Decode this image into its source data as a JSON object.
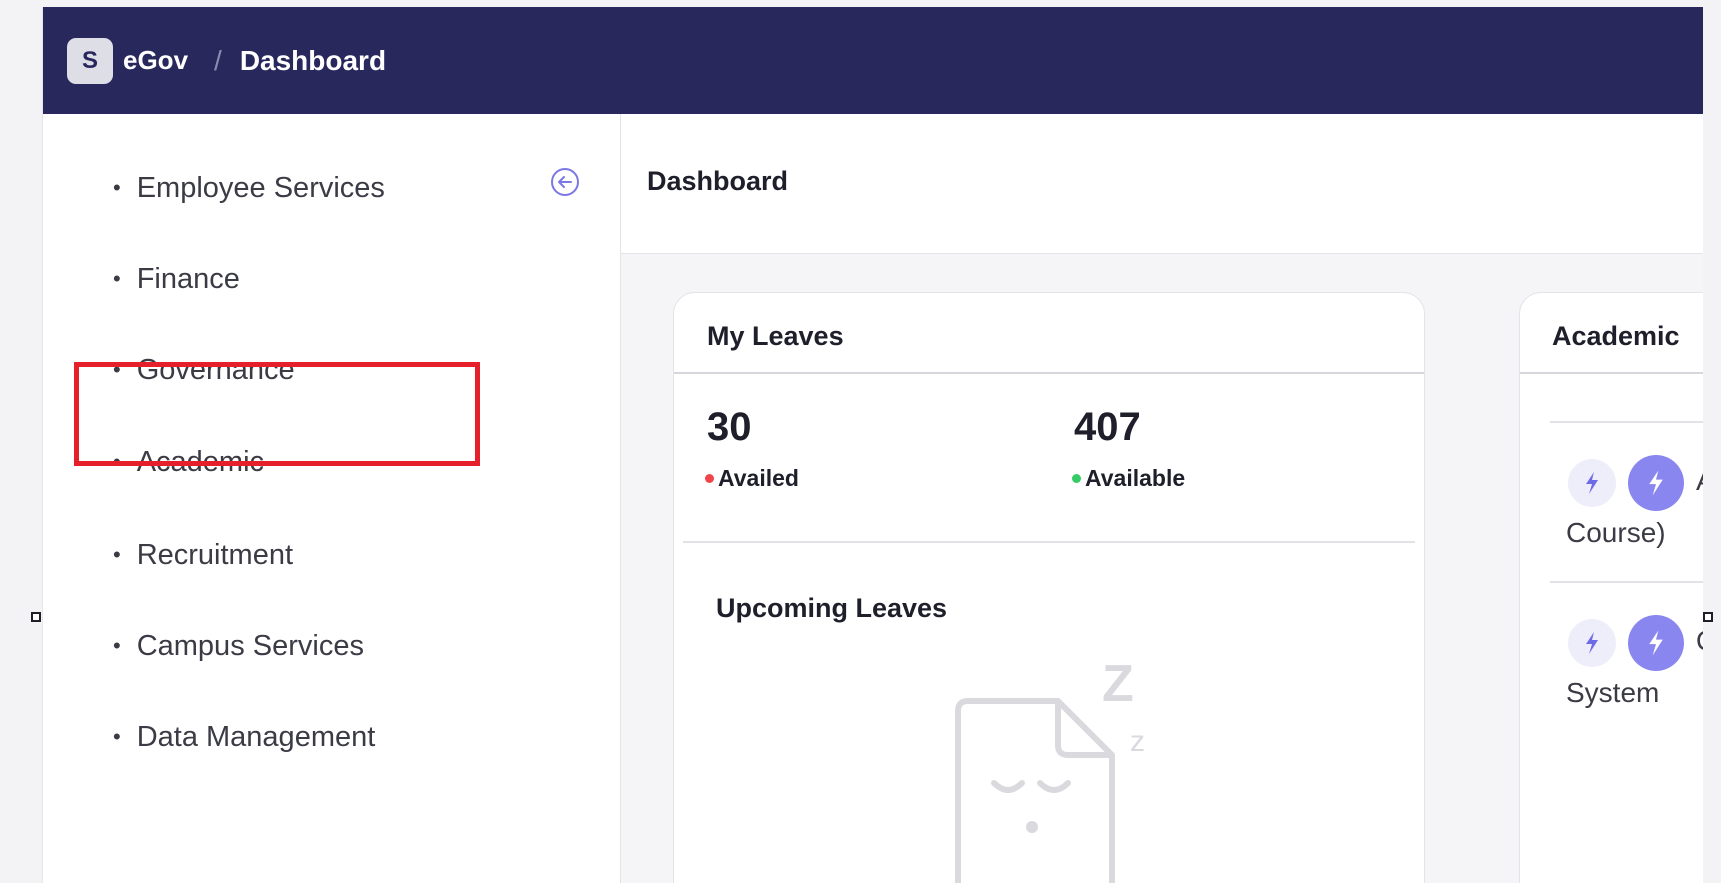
{
  "header": {
    "logo_letter": "S",
    "brand": "eGov",
    "separator": "/",
    "current": "Dashboard"
  },
  "sidebar": {
    "bullet": "•",
    "items": [
      {
        "label": "Employee Services"
      },
      {
        "label": "Finance"
      },
      {
        "label": "Governance"
      },
      {
        "label": "Academic"
      },
      {
        "label": "Recruitment"
      },
      {
        "label": "Campus Services"
      },
      {
        "label": "Data Management"
      }
    ]
  },
  "main": {
    "title": "Dashboard",
    "leaves": {
      "title": "My Leaves",
      "availed_value": "30",
      "availed_label": "Availed",
      "available_value": "407",
      "available_label": "Available",
      "upcoming_title": "Upcoming Leaves"
    },
    "academic": {
      "title": "Academic",
      "item1_line1": "As",
      "item1_line2": "Course)",
      "item2_line1": "Qu",
      "item2_line2": "System"
    }
  },
  "colors": {
    "topbar": "#29285d",
    "highlight": "#e5202a",
    "availed_dot": "#f0444a",
    "available_dot": "#33cc66",
    "accent": "#8a86f0"
  },
  "icons": {
    "collapse": "arrow-left-circle-icon",
    "empty_state": "sleeping-document-icon",
    "bolt": "lightning-bolt-icon"
  }
}
